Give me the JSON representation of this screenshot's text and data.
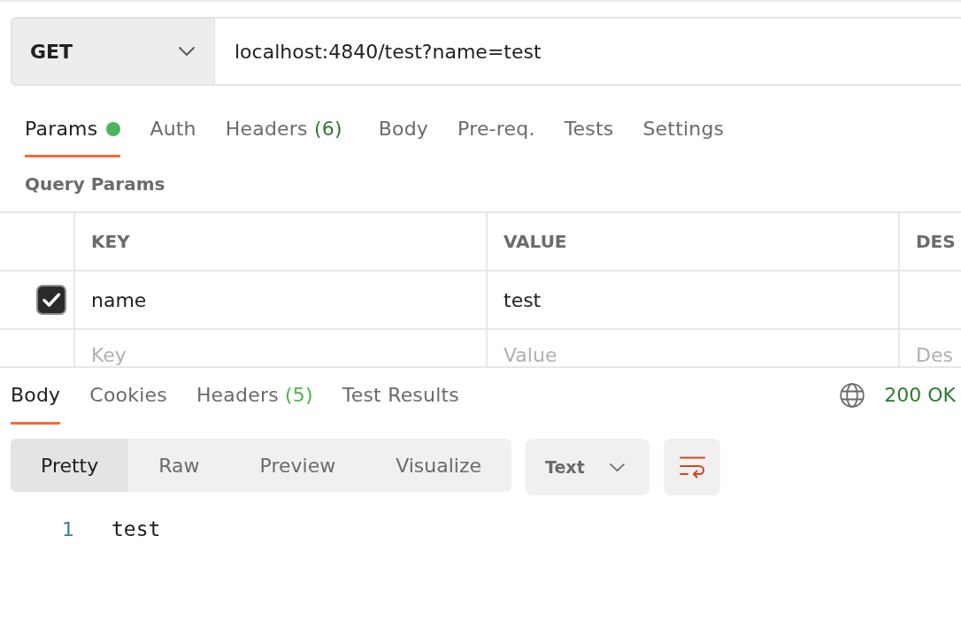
{
  "request": {
    "method": "GET",
    "url": "localhost:4840/test?name=test"
  },
  "request_tabs": [
    {
      "label": "Params",
      "selected": true,
      "dot": true
    },
    {
      "label": "Auth",
      "selected": false,
      "dot": false
    },
    {
      "label": "Headers",
      "count": "(6)",
      "selected": false,
      "dot": false
    },
    {
      "label": "Body",
      "selected": false,
      "dot": false
    },
    {
      "label": "Pre-req.",
      "selected": false,
      "dot": false
    },
    {
      "label": "Tests",
      "selected": false,
      "dot": false
    },
    {
      "label": "Settings",
      "selected": false,
      "dot": false
    }
  ],
  "query_params": {
    "title": "Query Params",
    "columns": [
      "KEY",
      "VALUE",
      "DES"
    ],
    "rows": [
      {
        "checked": true,
        "key": "name",
        "value": "test"
      }
    ],
    "new_row": {
      "key": {
        "placeholder": "Key"
      },
      "value": {
        "placeholder": "Value"
      },
      "description": {
        "placeholder": "Des"
      }
    }
  },
  "response": {
    "tabs": [
      {
        "label": "Body",
        "selected": true
      },
      {
        "label": "Cookies",
        "selected": false
      },
      {
        "label": "Headers",
        "count": "(5)",
        "selected": false
      },
      {
        "label": "Test Results",
        "selected": false
      }
    ],
    "status": "200 OK",
    "view_modes": [
      {
        "label": "Pretty",
        "selected": true
      },
      {
        "label": "Raw",
        "selected": false
      },
      {
        "label": "Preview",
        "selected": false
      },
      {
        "label": "Visualize",
        "selected": false
      }
    ],
    "format": "Text",
    "wrap_lines": true,
    "body_lines": [
      {
        "number": "1",
        "text": "test"
      }
    ]
  }
}
